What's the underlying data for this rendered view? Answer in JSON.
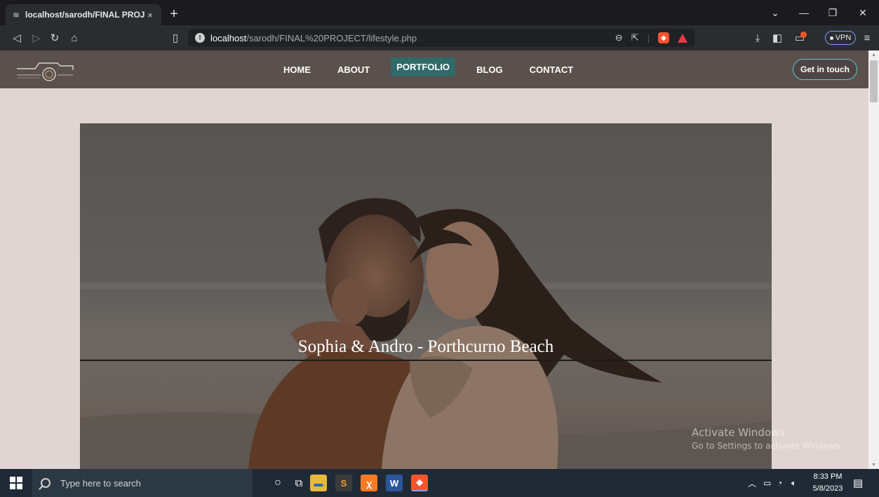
{
  "browser": {
    "tab_title": "localhost/sarodh/FINAL PROJECT",
    "tab_close": "×",
    "new_tab": "+",
    "url_host": "localhost",
    "url_path": "/sarodh/FINAL%20PROJECT/lifestyle.php",
    "vpn_label": "VPN"
  },
  "site": {
    "nav": {
      "items": [
        {
          "label": "HOME"
        },
        {
          "label": "ABOUT"
        },
        {
          "label": "PORTFOLIO"
        },
        {
          "label": "BLOG"
        },
        {
          "label": "CONTACT"
        }
      ],
      "active": "PORTFOLIO"
    },
    "cta_label": "Get in touch",
    "hero_caption": "Sophia & Andro - Porthcurno Beach"
  },
  "os": {
    "watermark_title": "Activate Windows",
    "watermark_sub": "Go to Settings to activate Windows.",
    "search_placeholder": "Type here to search",
    "time": "8:33 PM",
    "date": "5/8/2023"
  },
  "colors": {
    "nav_bg": "#5a504c",
    "active_bg": "#2f6b68",
    "page_bg": "#e0d5d0",
    "cta_border": "#5ec6d6"
  }
}
